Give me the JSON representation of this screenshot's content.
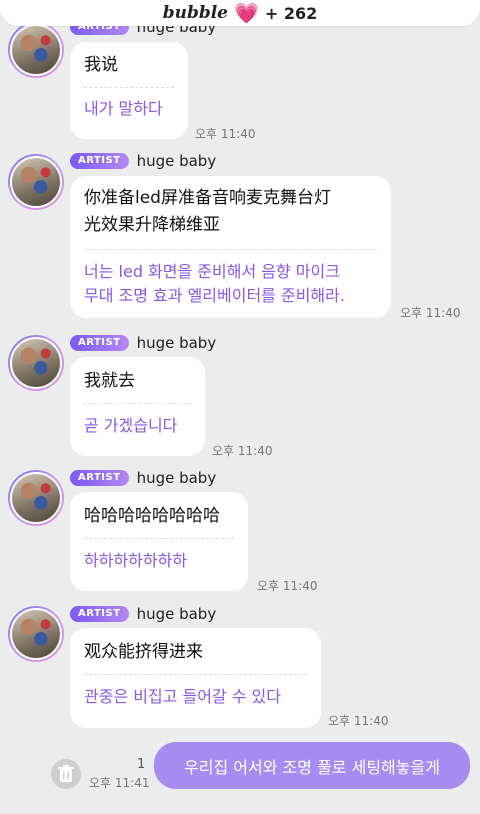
{
  "header": {
    "brand": "bubble",
    "heart": "💗",
    "count": "+ 262"
  },
  "messages": [
    {
      "badge": "ARTIST",
      "name": "huge baby",
      "original": "我说",
      "translation": "내가 말하다",
      "time": "오후 11:40"
    },
    {
      "badge": "ARTIST",
      "name": "huge baby",
      "original_lines": [
        "你准备led屏准备音响麦克舞台灯",
        "光效果升降梯维亚"
      ],
      "translation_lines": [
        "너는 led 화면을 준비해서 음향 마이크",
        "무대 조명 효과 엘리베이터를 준비해라."
      ],
      "time": "오후 11:40"
    },
    {
      "badge": "ARTIST",
      "name": "huge baby",
      "original": "我就去",
      "translation": "곧 가겠습니다",
      "time": "오후 11:40"
    },
    {
      "badge": "ARTIST",
      "name": "huge baby",
      "original": "哈哈哈哈哈哈哈哈",
      "translation": "하하하하하하하",
      "time": "오후 11:40"
    },
    {
      "badge": "ARTIST",
      "name": "huge baby",
      "original": "观众能挤得进来",
      "translation": "관중은 비집고 들어갈 수 있다",
      "time": "오후 11:40"
    }
  ],
  "outgoing": {
    "text": "우리집 어서와 조명 풀로 세팅해놓을게",
    "unread": "1",
    "time": "오후 11:41"
  },
  "colors": {
    "accent": "#8a57e6",
    "outgoing_bubble": "#a68cf1",
    "background": "#ececed"
  },
  "icons": {
    "delete": "trash-icon"
  }
}
